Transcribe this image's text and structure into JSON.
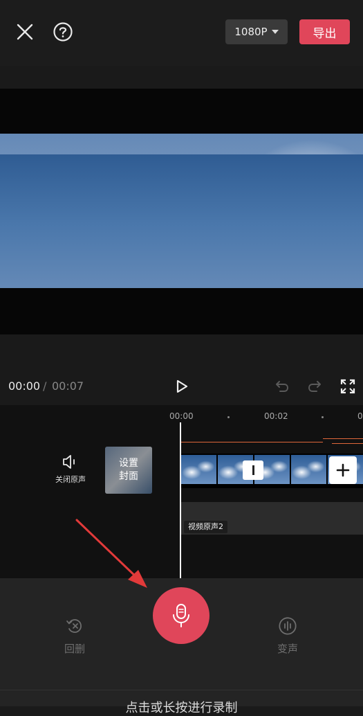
{
  "header": {
    "close_icon": "close-icon",
    "help_icon": "help-icon",
    "resolution": "1080P",
    "export_label": "导出"
  },
  "player": {
    "current_time": "00:00",
    "separator": "/",
    "total_time": "00:07",
    "play_icon": "play-icon",
    "undo_icon": "undo-icon",
    "redo_icon": "redo-icon",
    "fullscreen_icon": "fullscreen-icon"
  },
  "timeline": {
    "ruler": [
      "00:00",
      "00:02"
    ],
    "mute_label": "关闭原声",
    "cover_line1": "设置",
    "cover_line2": "封面",
    "audio_track_label": "视频原声2",
    "add_clip_icon": "plus-icon"
  },
  "recorder": {
    "undo_label": "回删",
    "voice_change_label": "变声",
    "mic_icon": "microphone-icon",
    "hint": "点击或长按进行录制"
  },
  "colors": {
    "accent": "#e0465a",
    "background": "#1a1a1a",
    "timeline_marker": "#e0673a"
  }
}
